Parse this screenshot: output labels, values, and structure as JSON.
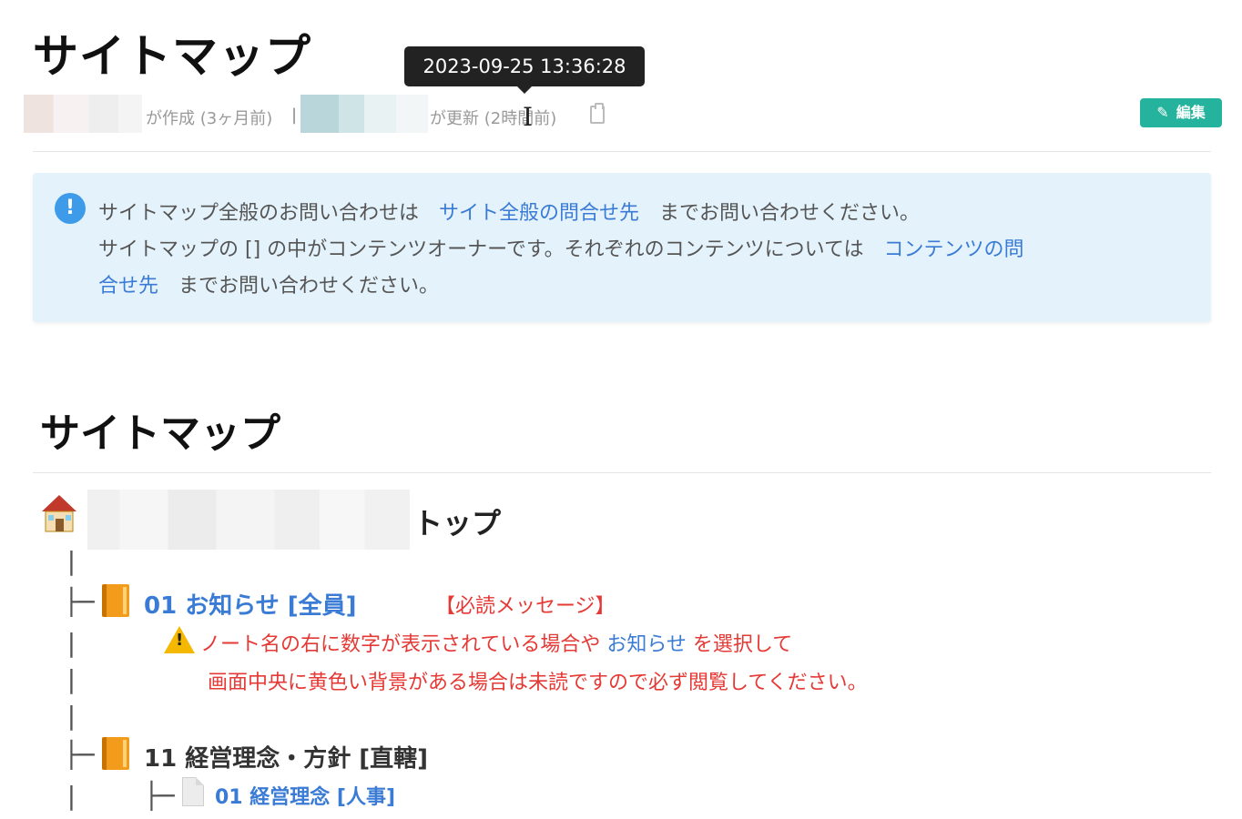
{
  "page": {
    "title": "サイトマップ"
  },
  "tooltip": {
    "text": "2023-09-25 13:36:28"
  },
  "meta": {
    "created": "が作成 (3ヶ月前)",
    "separator": "|",
    "updated": "が更新 (2時間前)"
  },
  "toolbar": {
    "edit_label": "編集"
  },
  "info": {
    "line1_prefix": "サイトマップ全般のお問い合わせは",
    "line1_link": "サイト全般の問合せ先",
    "line1_suffix": "までお問い合わせください。",
    "line2_prefix": "サイトマップの [] の中がコンテンツオーナーです。それぞれのコンテンツについては",
    "line2_link": "コンテンツの問",
    "line3_link": "合せ先",
    "line3_suffix": "までお問い合わせください。"
  },
  "sitemap": {
    "heading": "サイトマップ",
    "top_label": "トップ",
    "nodes": [
      {
        "label": "01 お知らせ [全員]",
        "tag": "【必読メッセージ】",
        "warning_line1_prefix": "ノート名の右に数字が表示されている場合や",
        "warning_line1_link": "お知らせ",
        "warning_line1_suffix": "を選択して",
        "warning_line2": "画面中央に黄色い背景がある場合は未読ですので必ず閲覧してください。"
      },
      {
        "label": "11 経営理念・方針 [直轄]",
        "children": [
          {
            "label": "01 経営理念 [人事]"
          }
        ]
      }
    ]
  },
  "colors": {
    "accent": "#26b39e",
    "link": "#3a7bd5",
    "warning": "#e53935",
    "info_bg": "#e4f2fb"
  },
  "icons": [
    "pencil-icon",
    "clipboard-icon",
    "info-icon",
    "house-icon",
    "book-icon",
    "warning-icon",
    "document-icon"
  ]
}
